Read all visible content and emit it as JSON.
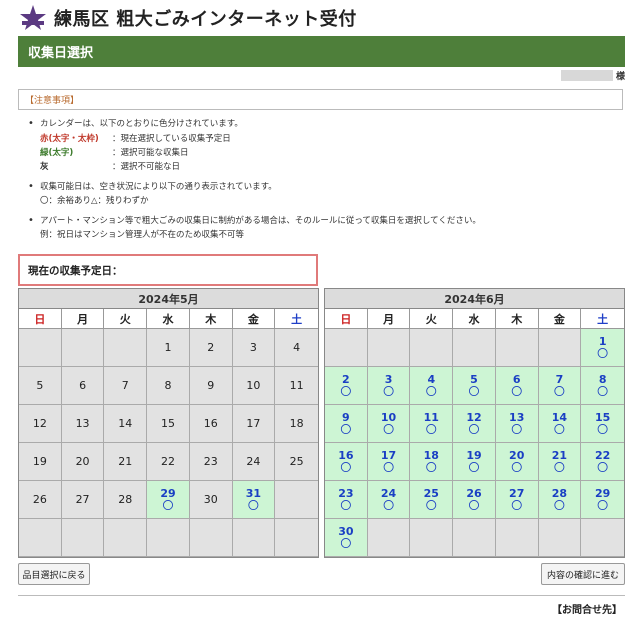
{
  "header": {
    "logo_icon": "nerima-ward-emblem-icon",
    "title": "練馬区 粗大ごみインターネット受付"
  },
  "page": {
    "section_title": "収集日選択",
    "user_suffix": "様"
  },
  "notice": {
    "heading": "【注意事項】",
    "items": [
      "カレンダーは、以下のとおりに色分けされています。",
      "収集可能日は、空き状況により以下の通り表示されています。",
      "アパート・マンション等で粗大ごみの収集日に制約がある場合は、そのルールに従って収集日を選択してください。"
    ],
    "legend": [
      {
        "key": "赤(太字・太枠)",
        "desc": "：現在選択している収集予定日"
      },
      {
        "key": "緑(太字)",
        "desc": "：選択可能な収集日"
      },
      {
        "key": "灰",
        "desc": "：選択不可能な日"
      }
    ],
    "availability_legend": "〇：余裕あり△：残りわずか",
    "example": "例：祝日はマンション管理人が不在のため収集不可等"
  },
  "current": {
    "label": "現在の収集予定日："
  },
  "weekdays": [
    "日",
    "月",
    "火",
    "水",
    "木",
    "金",
    "土"
  ],
  "colors": {
    "header_green": "#4e7f3a",
    "available_bg": "#cdf5d4",
    "available_text": "#1a3fc4",
    "unavailable_bg": "#e2e2e2",
    "sunday": "#cc1f1f",
    "saturday": "#1f3fc7",
    "current_border": "#e07a7a"
  },
  "calendars": [
    {
      "title": "2024年5月",
      "cells": [
        {
          "day": ""
        },
        {
          "day": ""
        },
        {
          "day": ""
        },
        {
          "day": "1"
        },
        {
          "day": "2"
        },
        {
          "day": "3"
        },
        {
          "day": "4"
        },
        {
          "day": "5"
        },
        {
          "day": "6"
        },
        {
          "day": "7"
        },
        {
          "day": "8"
        },
        {
          "day": "9"
        },
        {
          "day": "10"
        },
        {
          "day": "11"
        },
        {
          "day": "12"
        },
        {
          "day": "13"
        },
        {
          "day": "14"
        },
        {
          "day": "15"
        },
        {
          "day": "16"
        },
        {
          "day": "17"
        },
        {
          "day": "18"
        },
        {
          "day": "19"
        },
        {
          "day": "20"
        },
        {
          "day": "21"
        },
        {
          "day": "22"
        },
        {
          "day": "23"
        },
        {
          "day": "24"
        },
        {
          "day": "25"
        },
        {
          "day": "26"
        },
        {
          "day": "27"
        },
        {
          "day": "28"
        },
        {
          "day": "29",
          "available": true,
          "mark": "〇"
        },
        {
          "day": "30"
        },
        {
          "day": "31",
          "available": true,
          "mark": "〇"
        },
        {
          "day": ""
        },
        {
          "day": ""
        },
        {
          "day": ""
        },
        {
          "day": ""
        },
        {
          "day": ""
        },
        {
          "day": ""
        },
        {
          "day": ""
        },
        {
          "day": ""
        }
      ]
    },
    {
      "title": "2024年6月",
      "cells": [
        {
          "day": ""
        },
        {
          "day": ""
        },
        {
          "day": ""
        },
        {
          "day": ""
        },
        {
          "day": ""
        },
        {
          "day": ""
        },
        {
          "day": "1",
          "available": true,
          "mark": "〇"
        },
        {
          "day": "2",
          "available": true,
          "mark": "〇"
        },
        {
          "day": "3",
          "available": true,
          "mark": "〇"
        },
        {
          "day": "4",
          "available": true,
          "mark": "〇"
        },
        {
          "day": "5",
          "available": true,
          "mark": "〇"
        },
        {
          "day": "6",
          "available": true,
          "mark": "〇"
        },
        {
          "day": "7",
          "available": true,
          "mark": "〇"
        },
        {
          "day": "8",
          "available": true,
          "mark": "〇"
        },
        {
          "day": "9",
          "available": true,
          "mark": "〇"
        },
        {
          "day": "10",
          "available": true,
          "mark": "〇"
        },
        {
          "day": "11",
          "available": true,
          "mark": "〇"
        },
        {
          "day": "12",
          "available": true,
          "mark": "〇"
        },
        {
          "day": "13",
          "available": true,
          "mark": "〇"
        },
        {
          "day": "14",
          "available": true,
          "mark": "〇"
        },
        {
          "day": "15",
          "available": true,
          "mark": "〇"
        },
        {
          "day": "16",
          "available": true,
          "mark": "〇"
        },
        {
          "day": "17",
          "available": true,
          "mark": "〇"
        },
        {
          "day": "18",
          "available": true,
          "mark": "〇"
        },
        {
          "day": "19",
          "available": true,
          "mark": "〇"
        },
        {
          "day": "20",
          "available": true,
          "mark": "〇"
        },
        {
          "day": "21",
          "available": true,
          "mark": "〇"
        },
        {
          "day": "22",
          "available": true,
          "mark": "〇"
        },
        {
          "day": "23",
          "available": true,
          "mark": "〇"
        },
        {
          "day": "24",
          "available": true,
          "mark": "〇"
        },
        {
          "day": "25",
          "available": true,
          "mark": "〇"
        },
        {
          "day": "26",
          "available": true,
          "mark": "〇"
        },
        {
          "day": "27",
          "available": true,
          "mark": "〇"
        },
        {
          "day": "28",
          "available": true,
          "mark": "〇"
        },
        {
          "day": "29",
          "available": true,
          "mark": "〇"
        },
        {
          "day": "30",
          "available": true,
          "mark": "〇"
        },
        {
          "day": ""
        },
        {
          "day": ""
        },
        {
          "day": ""
        },
        {
          "day": ""
        },
        {
          "day": ""
        },
        {
          "day": ""
        }
      ]
    }
  ],
  "buttons": {
    "back": "品目選択に戻る",
    "next": "内容の確認に進む"
  },
  "footer": {
    "contact": "【お問合せ先】"
  }
}
